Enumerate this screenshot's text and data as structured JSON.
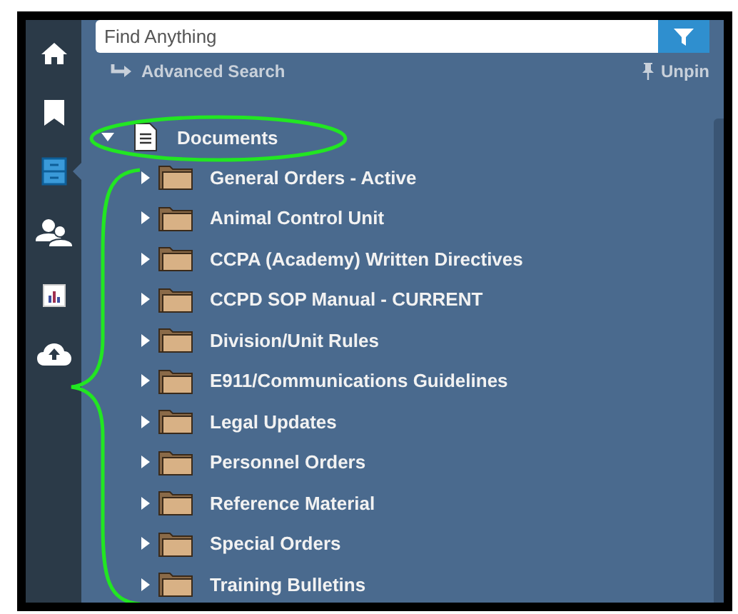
{
  "sidebar": {
    "items": [
      {
        "kind": "home",
        "selected": false
      },
      {
        "kind": "bookmark",
        "selected": false
      },
      {
        "kind": "cabinet",
        "selected": true
      },
      {
        "kind": "people",
        "selected": false
      },
      {
        "kind": "chart",
        "selected": false
      },
      {
        "kind": "upload",
        "selected": false
      }
    ]
  },
  "search": {
    "placeholder": "Find Anything"
  },
  "advanced_search": "Advanced Search",
  "unpin": "Unpin",
  "tree": {
    "label": "Documents",
    "expanded": true,
    "children": [
      {
        "label": "General Orders - Active",
        "expanded": false
      },
      {
        "label": "Animal Control Unit",
        "expanded": false
      },
      {
        "label": "CCPA (Academy) Written Directives",
        "expanded": false
      },
      {
        "label": "CCPD SOP Manual - CURRENT",
        "expanded": false
      },
      {
        "label": "Division/Unit Rules",
        "expanded": false
      },
      {
        "label": "E911/Communications Guidelines",
        "expanded": false
      },
      {
        "label": "Legal Updates",
        "expanded": false
      },
      {
        "label": "Personnel Orders",
        "expanded": false
      },
      {
        "label": "Reference Material",
        "expanded": false
      },
      {
        "label": "Special Orders",
        "expanded": false
      },
      {
        "label": "Training Bulletins",
        "expanded": false
      }
    ]
  }
}
